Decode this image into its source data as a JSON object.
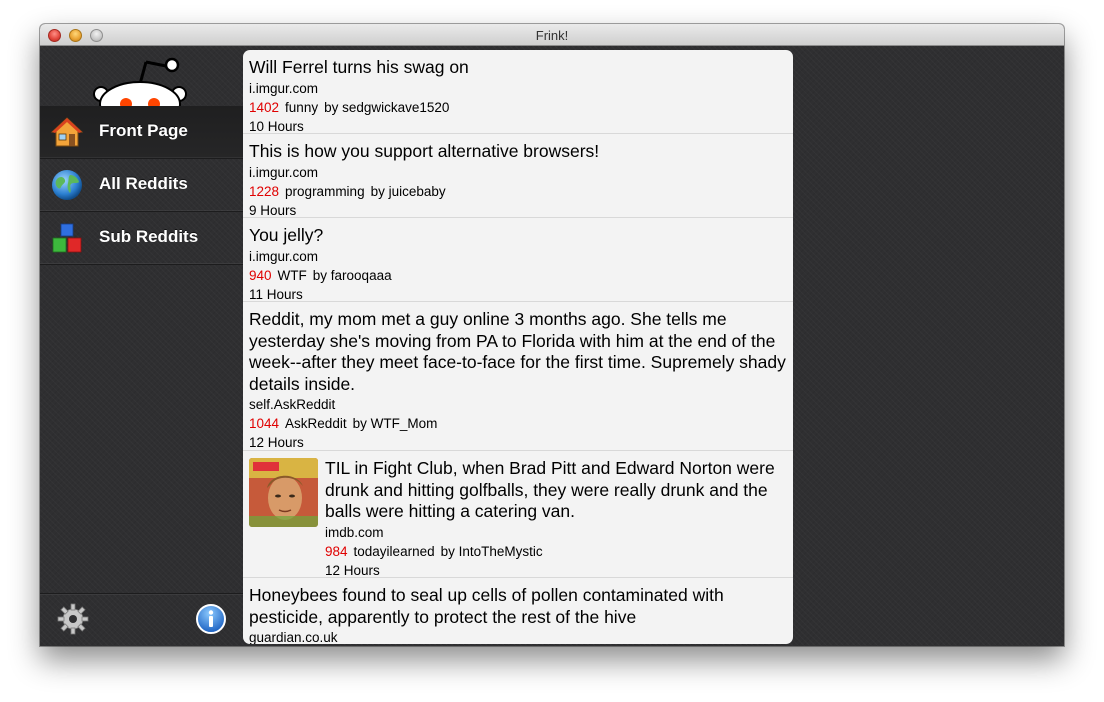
{
  "window": {
    "title": "Frink!"
  },
  "sidebar": {
    "items": [
      {
        "label": "Front Page",
        "icon": "home-icon"
      },
      {
        "label": "All Reddits",
        "icon": "globe-icon"
      },
      {
        "label": "Sub Reddits",
        "icon": "blocks-icon"
      }
    ],
    "footer": {
      "settings_icon": "gear-icon",
      "info_icon": "info-icon"
    }
  },
  "feed": {
    "posts": [
      {
        "title": "Will Ferrel turns his swag on",
        "domain": "i.imgur.com",
        "score": "1402",
        "subreddit": "funny",
        "author": "by sedgwickave1520",
        "age": "10 Hours"
      },
      {
        "title": "This is how you support alternative browsers!",
        "domain": "i.imgur.com",
        "score": "1228",
        "subreddit": "programming",
        "author": "by juicebaby",
        "age": "9 Hours"
      },
      {
        "title": "You jelly?",
        "domain": "i.imgur.com",
        "score": "940",
        "subreddit": "WTF",
        "author": "by farooqaaa",
        "age": "11 Hours"
      },
      {
        "title": "Reddit, my mom met a guy online 3 months ago. She tells me yesterday she's moving from PA to Florida with him at the end of the week--after they meet face-to-face for the first time. Supremely shady details inside.",
        "domain": "self.AskReddit",
        "score": "1044",
        "subreddit": "AskReddit",
        "author": "by WTF_Mom",
        "age": "12 Hours"
      },
      {
        "title": "TIL in Fight Club, when Brad Pitt and Edward Norton were drunk and hitting golfballs, they were really drunk and the balls were hitting a catering van.",
        "domain": "imdb.com",
        "score": "984",
        "subreddit": "todayilearned",
        "author": "by IntoTheMystic",
        "age": "12 Hours",
        "thumbnail": "fight-club-poster-thumbnail"
      },
      {
        "title": "Honeybees found to seal up cells of pollen contaminated with pesticide, apparently to protect the rest of the hive",
        "domain": "guardian.co.uk",
        "score": "",
        "subreddit": "",
        "author": "",
        "age": ""
      }
    ]
  },
  "colors": {
    "score": "#e00000",
    "sidebar_bg": "#2f2f31",
    "feed_bg": "#f3f3f3"
  }
}
